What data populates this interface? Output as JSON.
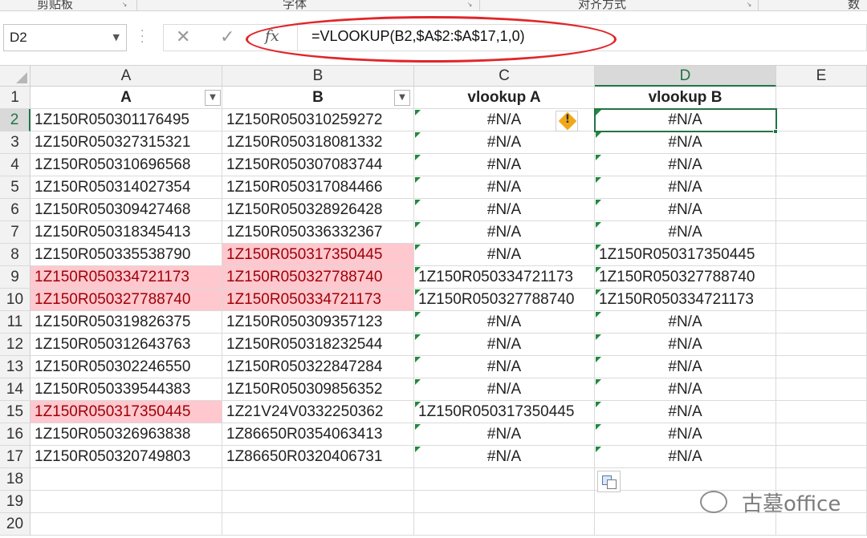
{
  "ribbon": {
    "groups": [
      "剪贴板",
      "字体",
      "对齐方式",
      "数字"
    ]
  },
  "formula_bar": {
    "name_box": "D2",
    "fx_label": "fx",
    "cancel_icon": "✕",
    "enter_icon": "✓",
    "formula": "=VLOOKUP(B2,$A$2:$A$17,1,0)"
  },
  "columns": [
    "A",
    "B",
    "C",
    "D",
    "E"
  ],
  "rows": [
    "1",
    "2",
    "3",
    "4",
    "5",
    "6",
    "7",
    "8",
    "9",
    "10",
    "11",
    "12",
    "13",
    "14",
    "15",
    "16",
    "17",
    "18",
    "19",
    "20"
  ],
  "headers": {
    "a": "A",
    "b": "B",
    "c": "vlookup A",
    "d": "vlookup B"
  },
  "data": [
    {
      "a": "1Z150R050301176495",
      "b": "1Z150R050310259272",
      "c": "#N/A",
      "d": "#N/A"
    },
    {
      "a": "1Z150R050327315321",
      "b": "1Z150R050318081332",
      "c": "#N/A",
      "d": "#N/A"
    },
    {
      "a": "1Z150R050310696568",
      "b": "1Z150R050307083744",
      "c": "#N/A",
      "d": "#N/A"
    },
    {
      "a": "1Z150R050314027354",
      "b": "1Z150R050317084466",
      "c": "#N/A",
      "d": "#N/A"
    },
    {
      "a": "1Z150R050309427468",
      "b": "1Z150R050328926428",
      "c": "#N/A",
      "d": "#N/A"
    },
    {
      "a": "1Z150R050318345413",
      "b": "1Z150R050336332367",
      "c": "#N/A",
      "d": "#N/A"
    },
    {
      "a": "1Z150R050335538790",
      "b": "1Z150R050317350445",
      "c": "#N/A",
      "d": "1Z150R050317350445"
    },
    {
      "a": "1Z150R050334721173",
      "b": "1Z150R050327788740",
      "c": "1Z150R050334721173",
      "d": "1Z150R050327788740"
    },
    {
      "a": "1Z150R050327788740",
      "b": "1Z150R050334721173",
      "c": "1Z150R050327788740",
      "d": "1Z150R050334721173"
    },
    {
      "a": "1Z150R050319826375",
      "b": "1Z150R050309357123",
      "c": "#N/A",
      "d": "#N/A"
    },
    {
      "a": "1Z150R050312643763",
      "b": "1Z150R050318232544",
      "c": "#N/A",
      "d": "#N/A"
    },
    {
      "a": "1Z150R050302246550",
      "b": "1Z150R050322847284",
      "c": "#N/A",
      "d": "#N/A"
    },
    {
      "a": "1Z150R050339544383",
      "b": " 1Z150R050309856352",
      "c": "#N/A",
      "d": "#N/A"
    },
    {
      "a": "1Z150R050317350445",
      "b": "1Z21V24V0332250362",
      "c": "1Z150R050317350445",
      "d": "#N/A"
    },
    {
      "a": "1Z150R050326963838",
      "b": "1Z86650R0354063413",
      "c": "#N/A",
      "d": "#N/A"
    },
    {
      "a": "1Z150R050320749803",
      "b": "1Z86650R0320406731",
      "c": "#N/A",
      "d": "#N/A"
    }
  ],
  "highlight": {
    "a": [
      9,
      10,
      15
    ],
    "b": [
      8,
      9,
      10
    ]
  },
  "selected_cell": "D2",
  "watermark": "古墓office",
  "colors": {
    "duplicate_fill": "#ffc7ce",
    "duplicate_text": "#9c0006",
    "selection": "#217346",
    "annotation": "#e0262a"
  }
}
